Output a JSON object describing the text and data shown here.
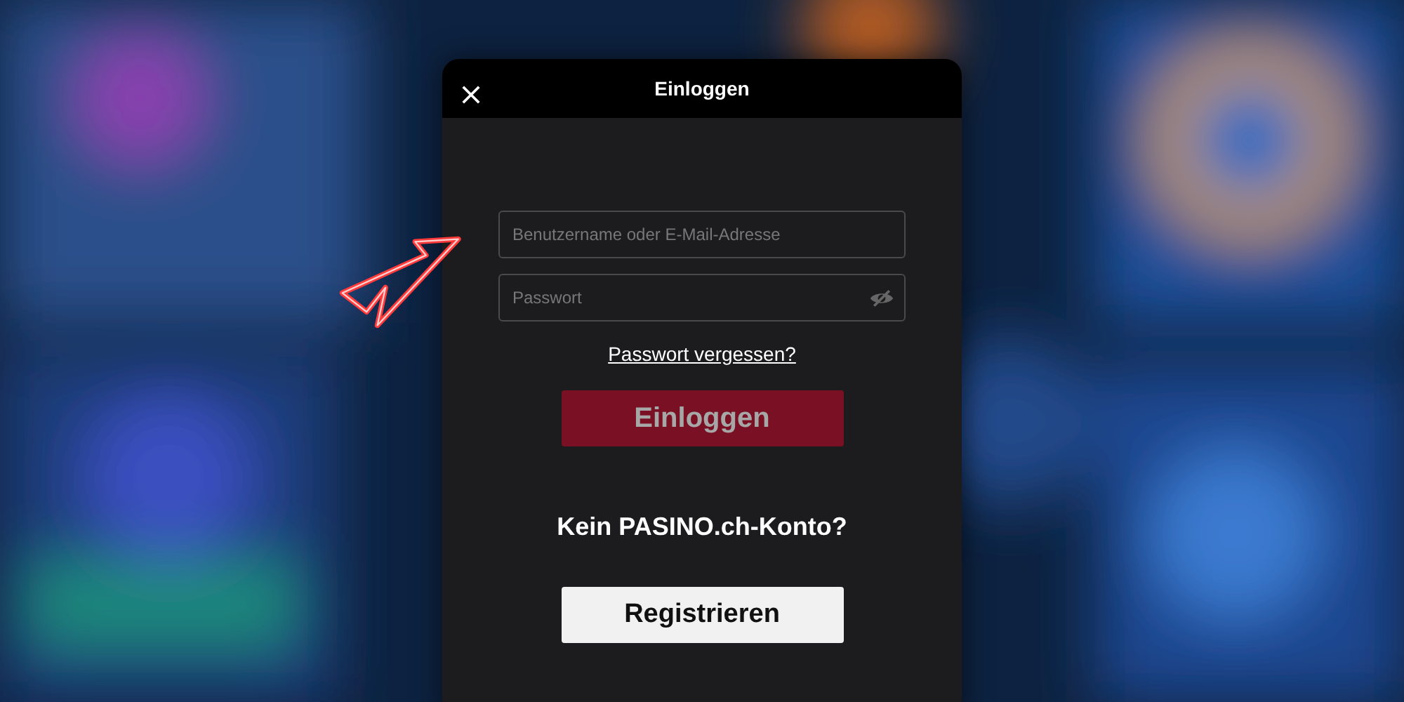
{
  "dialog": {
    "title": "Einloggen"
  },
  "fields": [
    {
      "placeholder": "Benutzername oder E-Mail-Adresse",
      "kind": "text"
    },
    {
      "placeholder": "Passwort",
      "kind": "password"
    }
  ],
  "forgot_link": "Passwort vergessen?",
  "login_button": {
    "label": "Einloggen",
    "disabled": true
  },
  "signup_prompt": "Kein PASINO.ch-Konto?",
  "register_button": "Registrieren"
}
